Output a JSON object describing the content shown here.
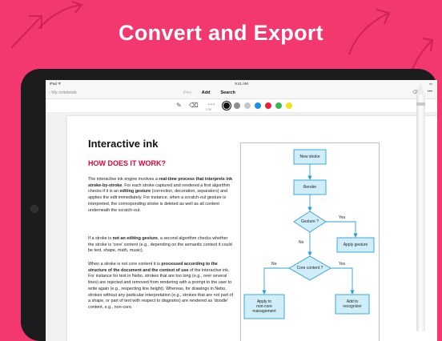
{
  "headline": "Convert and Export",
  "colors": {
    "background": "#f2386f",
    "headline_text": "#ffffff",
    "subtitle_red": "#e8003a",
    "diagram_fill": "#cfeefa",
    "diagram_stroke": "#2d9fd0"
  },
  "status_bar": {
    "carrier": "iPad ᯤ",
    "time": "9:41 AM",
    "battery": "▭"
  },
  "nav": {
    "back_label": "‹ My notebook",
    "tabs": [
      {
        "label": "Pen",
        "state": "muted"
      },
      {
        "label": "Add",
        "state": "normal"
      },
      {
        "label": "Search",
        "state": "normal"
      }
    ],
    "icons": [
      "convert-icon",
      "more-icon"
    ],
    "convert_glyph": "⌫",
    "more_glyph": "•••"
  },
  "toolbar": {
    "stroke_size_label": "0.35",
    "stroke_dots": "• • •",
    "tools": [
      "pen-icon",
      "eraser-icon"
    ],
    "swatches": [
      {
        "name": "black",
        "color": "#111111",
        "selected": true
      },
      {
        "name": "gray",
        "color": "#8e8e8e",
        "selected": false
      },
      {
        "name": "light-gray",
        "color": "#c8c8c8",
        "selected": false
      },
      {
        "name": "blue",
        "color": "#1e8fe6",
        "selected": false
      },
      {
        "name": "red",
        "color": "#e8223c",
        "selected": false
      },
      {
        "name": "green",
        "color": "#34b853",
        "selected": false
      },
      {
        "name": "yellow",
        "color": "#f2e21c",
        "selected": false
      }
    ]
  },
  "document": {
    "title": "Interactive ink",
    "subtitle": "HOW DOES IT WORK?",
    "p1": [
      "The interactive ink engine involves a ",
      "real-time process that interprets ink stroke-by-stroke",
      ". For each stroke captured and rendered a first algorithm checks if it is an ",
      "editing gesture",
      " (correction, decoration, separators) and applies the edit immediately. For instance, when a scratch-out gesture is interpreted, the corresponding stroke is deleted as well as all content underneath the scratch-out."
    ],
    "p2": [
      "If a stroke is ",
      "not an editing gesture",
      ", a second algorithm checks whether the stroke is 'core' content (e.g., depending on the semantic context it could be text, shape, math, music)."
    ],
    "p3": [
      "When a stroke is not core content it is ",
      "processed according to the structure of the document and the context of use",
      " of the interactive ink. For instance for text in Nebo, strokes that are too long (e.g., over several lines) are rejected and removed from rendering with a prompt to the user to write again (e.g., respecting line height). Whereas, for drawings in Nebo, strokes without any particular interpretation (e.g., strokes that are not part of a shape, or part of text with respect to diagrams) are rendered as 'doodle' content, e.g., non-core."
    ]
  },
  "flowchart": {
    "nodes": {
      "new_stroke": "New stroke",
      "render": "Render",
      "gesture": "Gesture ?",
      "apply_gesture": "Apply gesture",
      "core_content": "Core content ?",
      "apply_non_core": "Apply to\nnon-core\nmanagement",
      "add_to_recognizer": "Add to\nrecognizer"
    },
    "edge_labels": {
      "gesture_yes": "Yes",
      "gesture_no": "No",
      "core_no": "No",
      "core_yes": "Yes"
    }
  }
}
